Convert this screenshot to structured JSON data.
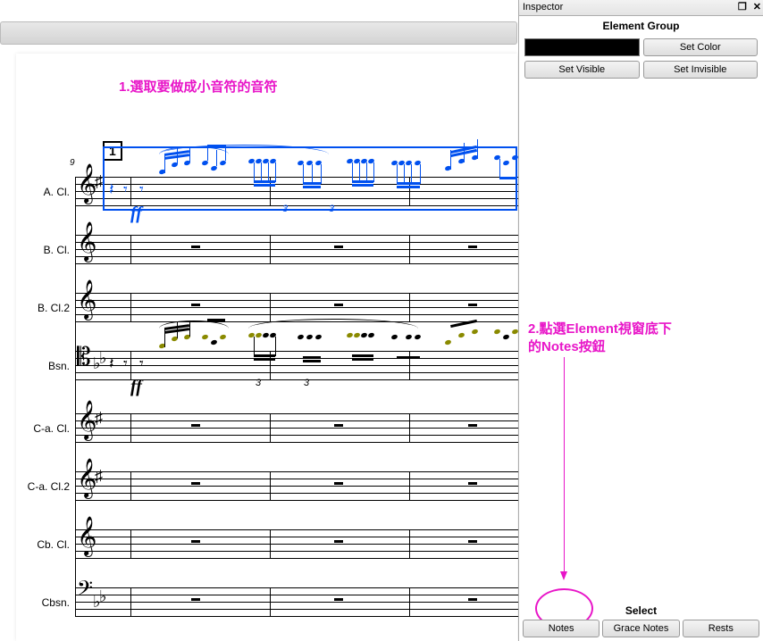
{
  "inspector": {
    "title": "Inspector",
    "element_group": "Element Group",
    "set_color": "Set Color",
    "set_visible": "Set Visible",
    "set_invisible": "Set Invisible",
    "select_label": "Select",
    "notes_btn": "Notes",
    "grace_notes_btn": "Grace Notes",
    "rests_btn": "Rests",
    "color_value": "#000000"
  },
  "score": {
    "measure_number": "9",
    "rehearsal_mark": "1",
    "instruments": [
      "A. Cl.",
      "B. Cl.",
      "B. Cl.2",
      "Bsn.",
      "C-a. Cl.",
      "C-a. Cl.2",
      "Cb. Cl.",
      "Cbsn."
    ],
    "dynamic_acl": "ff",
    "dynamic_bsn": "ff",
    "tuplet_3a": "3",
    "tuplet_3b": "3"
  },
  "annotations": {
    "step1": "1.選取要做成小音符的音符",
    "step2a": "2.點選Element視窗底下",
    "step2b": "的Notes按鈕"
  }
}
